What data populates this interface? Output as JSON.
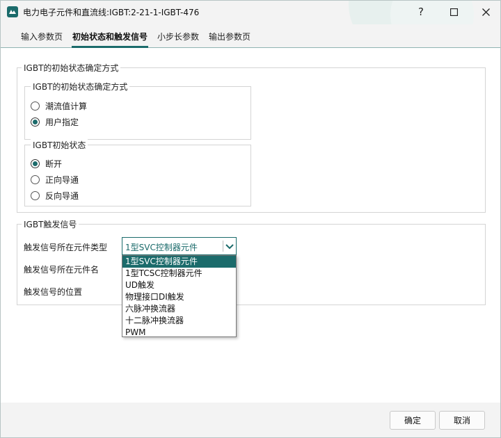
{
  "window": {
    "title": "电力电子元件和直流线:IGBT:2-21-1-IGBT-476",
    "help_glyph": "?",
    "maximize_glyph": "☐",
    "close_glyph": "✕"
  },
  "tabs": [
    {
      "label": "输入参数页",
      "active": false
    },
    {
      "label": "初始状态和触发信号",
      "active": true
    },
    {
      "label": "小步长参数",
      "active": false
    },
    {
      "label": "输出参数页",
      "active": false
    }
  ],
  "init_state_group": {
    "title": "IGBT的初始状态确定方式",
    "method_group": {
      "title": "IGBT的初始状态确定方式",
      "options": [
        {
          "label": "潮流值计算",
          "checked": false
        },
        {
          "label": "用户指定",
          "checked": true
        }
      ]
    },
    "state_group": {
      "title": "IGBT初始状态",
      "options": [
        {
          "label": "断开",
          "checked": true
        },
        {
          "label": "正向导通",
          "checked": false
        },
        {
          "label": "反向导通",
          "checked": false
        }
      ]
    }
  },
  "trigger_group": {
    "title": "IGBT触发信号",
    "fields": {
      "type_label": "触发信号所在元件类型",
      "name_label": "触发信号所在元件名",
      "position_label": "触发信号的位置"
    },
    "type_combo": {
      "value": "1型SVC控制器元件",
      "options": [
        {
          "label": "1型SVC控制器元件",
          "selected": true
        },
        {
          "label": "1型TCSC控制器元件",
          "selected": false
        },
        {
          "label": "UD触发",
          "selected": false
        },
        {
          "label": "物理接口DI触发",
          "selected": false
        },
        {
          "label": "六脉冲换流器",
          "selected": false
        },
        {
          "label": "十二脉冲换流器",
          "selected": false
        },
        {
          "label": "PWM",
          "selected": false
        }
      ]
    }
  },
  "footer": {
    "ok_label": "确定",
    "cancel_label": "取消"
  },
  "colors": {
    "accent": "#1b6b6b",
    "title_bar_bg": "#f3f3f3",
    "content_bg": "#ffffff"
  },
  "icons": {
    "app": "app-logo-icon",
    "combo_arrow": "chevron-down-icon"
  }
}
